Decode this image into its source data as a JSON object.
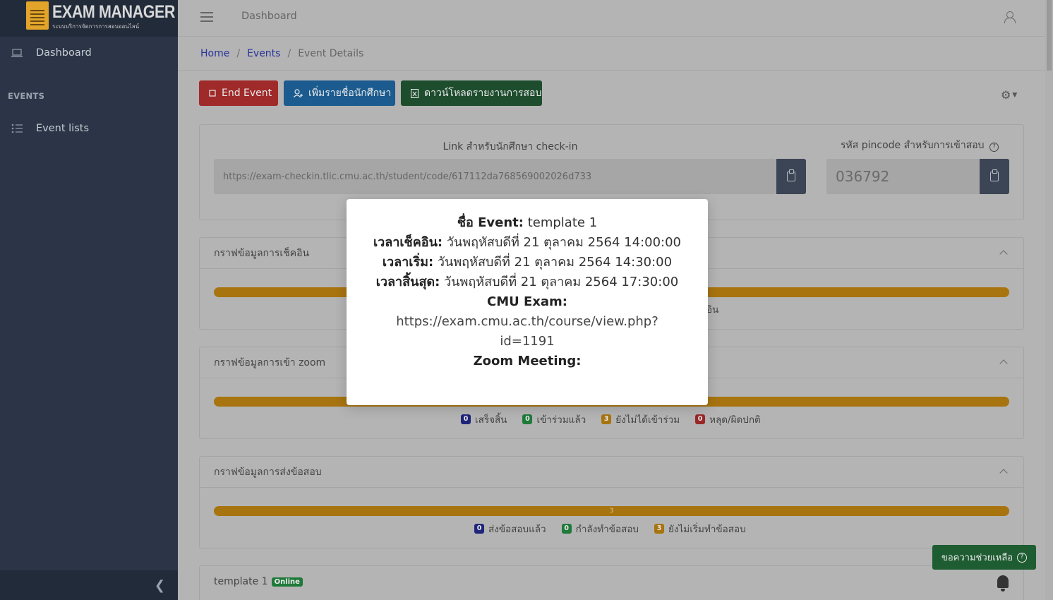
{
  "brand": {
    "title": "EXAM MANAGER",
    "subtitle": "ระบบบริการจัดการการสอบออนไลน์"
  },
  "sidebar": {
    "items": [
      {
        "label": "Dashboard",
        "icon": "laptop-icon"
      },
      {
        "label": "Event lists",
        "icon": "list-icon"
      }
    ],
    "section_heading": "EVENTS"
  },
  "header": {
    "title": "Dashboard"
  },
  "breadcrumb": {
    "home": "Home",
    "events": "Events",
    "current": "Event Details"
  },
  "actions": {
    "end_event": "End Event",
    "add_students": "เพิ่มรายชื่อนักศึกษา",
    "download_report": "ดาวน์โหลดรายงานการสอบ"
  },
  "checkin_link": {
    "label": "Link สำหรับนักศึกษา check-in",
    "value": "https://exam-checkin.tlic.cmu.ac.th/student/code/617112da768569002026d733"
  },
  "pincode": {
    "label": "รหัส pincode สำหรับการเข้าสอบ",
    "value": "036792"
  },
  "checkin_chart": {
    "title": "กราฟข้อมูลการเช็คอิน",
    "partial_legend": "อิน"
  },
  "zoom_chart": {
    "title": "กราฟข้อมูลการเข้า zoom",
    "legend": [
      {
        "count": "0",
        "label": "เสร็จสิ้น",
        "color": "#1f257a"
      },
      {
        "count": "0",
        "label": "เข้าร่วมแล้ว",
        "color": "#1f7a3a"
      },
      {
        "count": "3",
        "label": "ยังไม่ได้เข้าร่วม",
        "color": "#a8740f"
      },
      {
        "count": "0",
        "label": "หลุด/ผิดปกติ",
        "color": "#9a2727"
      }
    ]
  },
  "submit_chart": {
    "title": "กราฟข้อมูลการส่งข้อสอบ",
    "bar_label": "3",
    "legend": [
      {
        "count": "0",
        "label": "ส่งข้อสอบแล้ว",
        "color": "#1f257a"
      },
      {
        "count": "0",
        "label": "กำลังทำข้อสอบ",
        "color": "#1f7a3a"
      },
      {
        "count": "3",
        "label": "ยังไม่เริ่มทำข้อสอบ",
        "color": "#a8740f"
      }
    ]
  },
  "event_card": {
    "name": "template 1",
    "status": "Online"
  },
  "help": {
    "label": "ขอความช่วยเหลือ"
  },
  "modal": {
    "event_key": "ชื่อ Event:",
    "event_value": "template 1",
    "checkin_key": "เวลาเช็คอิน:",
    "checkin_value": "วันพฤหัสบดีที่ 21 ตุลาคม 2564 14:00:00",
    "start_key": "เวลาเริ่ม:",
    "start_value": "วันพฤหัสบดีที่ 21 ตุลาคม 2564 14:30:00",
    "end_key": "เวลาสิ้นสุด:",
    "end_value": "วันพฤหัสบดีที่ 21 ตุลาคม 2564 17:30:00",
    "cmu_key": "CMU Exam:",
    "cmu_url_1": "https://exam.cmu.ac.th/course/view.php?",
    "cmu_url_2": "id=1191",
    "zoom_key": "Zoom Meeting:"
  }
}
